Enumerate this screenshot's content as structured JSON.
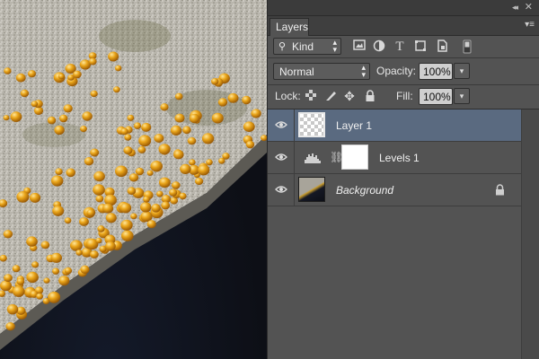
{
  "panel": {
    "tab_label": "Layers",
    "collapse_glyph": "◂◂",
    "close_glyph": "✕",
    "menu_glyph": "▾≡"
  },
  "filter": {
    "kind_label": "Kind",
    "search_glyph": "⚲",
    "icons": [
      "image-filter-icon",
      "adjustment-filter-icon",
      "type-filter-icon",
      "shape-filter-icon",
      "smart-object-filter-icon",
      "filter-toggle-icon"
    ]
  },
  "blend": {
    "mode": "Normal",
    "opacity_label": "Opacity:",
    "opacity_value": "100%",
    "lock_label": "Lock:",
    "fill_label": "Fill:",
    "fill_value": "100%"
  },
  "layers": [
    {
      "name": "Layer 1",
      "selected": true,
      "type": "transparent"
    },
    {
      "name": "Levels 1",
      "selected": false,
      "type": "adjustment"
    },
    {
      "name": "Background",
      "selected": false,
      "type": "background",
      "locked": true
    }
  ],
  "colors": {
    "panel_bg": "#535353",
    "selected_row": "#5a6a80",
    "droplets": "#e8a318"
  }
}
